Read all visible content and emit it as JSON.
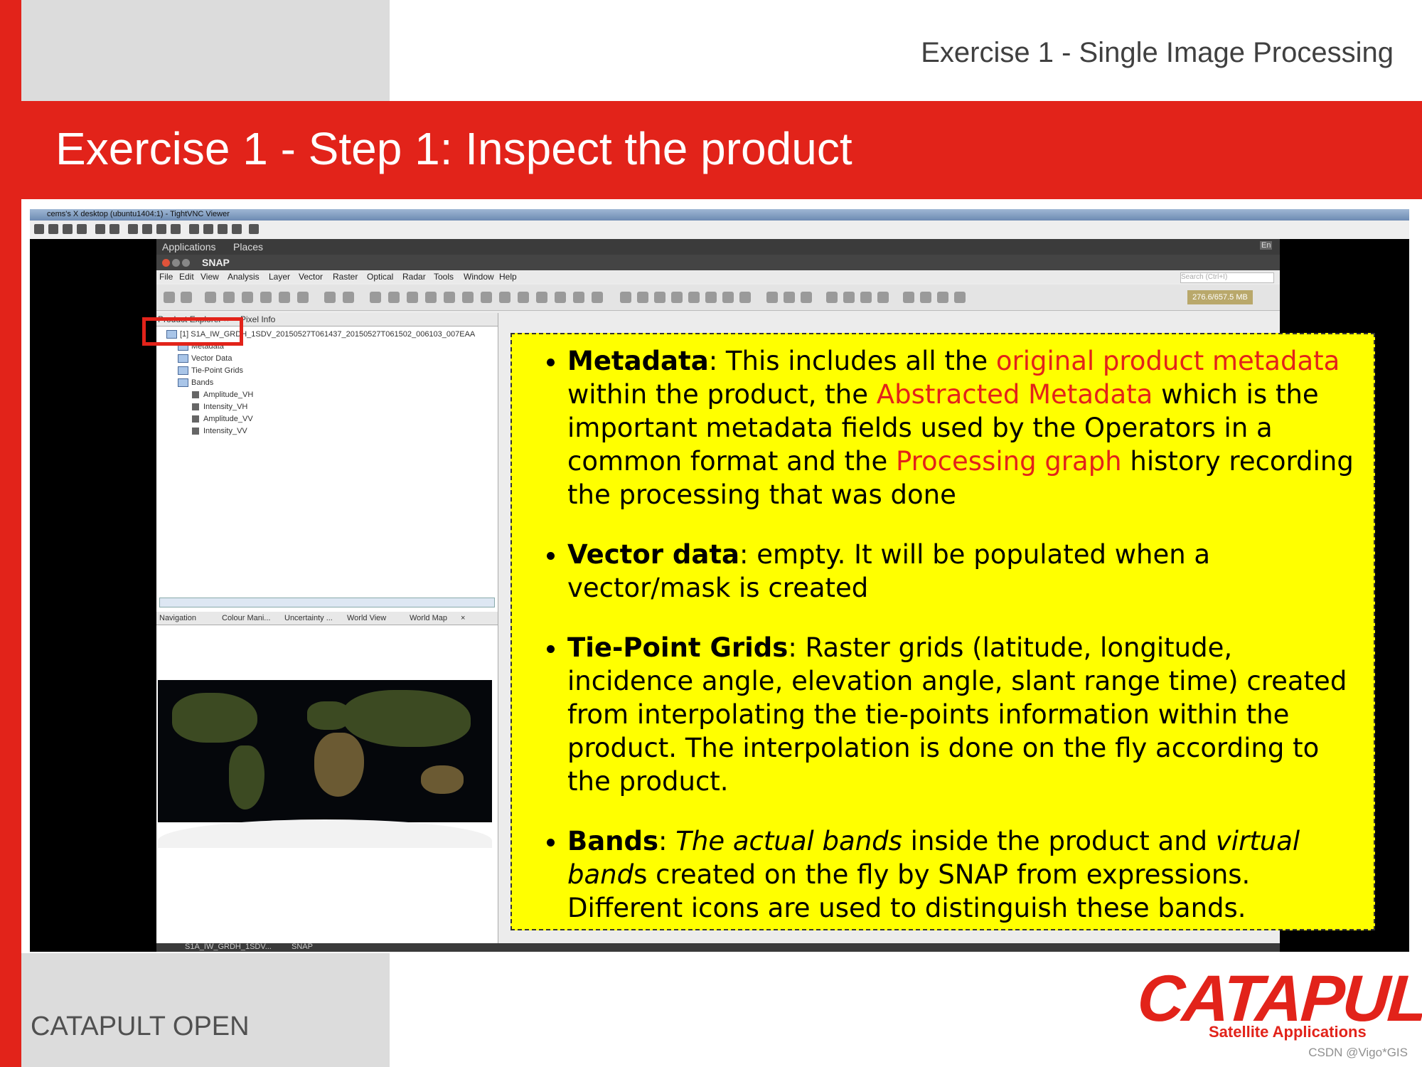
{
  "slide": {
    "header": "Exercise 1 - Single Image Processing",
    "title": "Exercise 1 - Step 1: Inspect the product",
    "footer": "CATAPULT OPEN",
    "logo_word": "CATAPULT",
    "logo_sub": "Satellite Applications",
    "watermark": "CSDN @Vigo*GIS",
    "accent_color": "#e2231a",
    "callout_color": "#ffff00"
  },
  "vnc": {
    "title": "cems's X desktop (ubuntu1404:1) - TightVNC Viewer"
  },
  "snap": {
    "gnome_bar": {
      "applications": "Applications",
      "places": "Places",
      "lang": "En"
    },
    "window_title": "SNAP",
    "menu": [
      "File",
      "Edit",
      "View",
      "Analysis",
      "Layer",
      "Vector",
      "Raster",
      "Optical",
      "Radar",
      "Tools",
      "Window",
      "Help"
    ],
    "search_placeholder": "Search (Ctrl+I)",
    "memory": "276.6/657.5 MB",
    "tabs": {
      "product_explorer": "Product Explorer",
      "pixel_info": "Pixel Info",
      "close": "×"
    },
    "tree": {
      "product": "[1] S1A_IW_GRDH_1SDV_20150527T061437_20150527T061502_006103_007EAA",
      "metadata": "Metadata",
      "vector_data": "Vector Data",
      "tie_point_grids": "Tie-Point Grids",
      "bands": "Bands",
      "band_items": [
        "Amplitude_VH",
        "Intensity_VH",
        "Amplitude_VV",
        "Intensity_VV"
      ]
    },
    "nav_tabs": [
      "Navigation",
      "Colour Mani...",
      "Uncertainty ...",
      "World View",
      "World Map"
    ],
    "taskbar": {
      "product": "S1A_IW_GRDH_1SDV...",
      "app": "SNAP"
    }
  },
  "callout": {
    "metadata": {
      "term": "Metadata",
      "t1": ": This includes all the ",
      "r1": "original product metadata",
      "t2": " within the product, the ",
      "r2": "Abstracted Metadata",
      "t3": " which is the important metadata fields used by the Operators in a common format and the ",
      "r3": "Processing graph",
      "t4": " history recording the processing that was done"
    },
    "vector": {
      "term": "Vector data",
      "t1": ": empty. It will be populated when a vector/mask is created"
    },
    "tiepoint": {
      "term": "Tie-Point Grids",
      "t1": ": Raster grids (latitude, longitude, incidence angle, elevation angle, slant range time) created from interpolating the tie-points information within the product. The interpolation is done on the fly according to the product."
    },
    "bands": {
      "term": "Bands",
      "t1": ": ",
      "i1": "The actual bands",
      "t2": " inside the product and ",
      "i2": "virtual band",
      "t3": "s created on the fly by SNAP from expressions. Different icons are used to distinguish these bands."
    }
  }
}
